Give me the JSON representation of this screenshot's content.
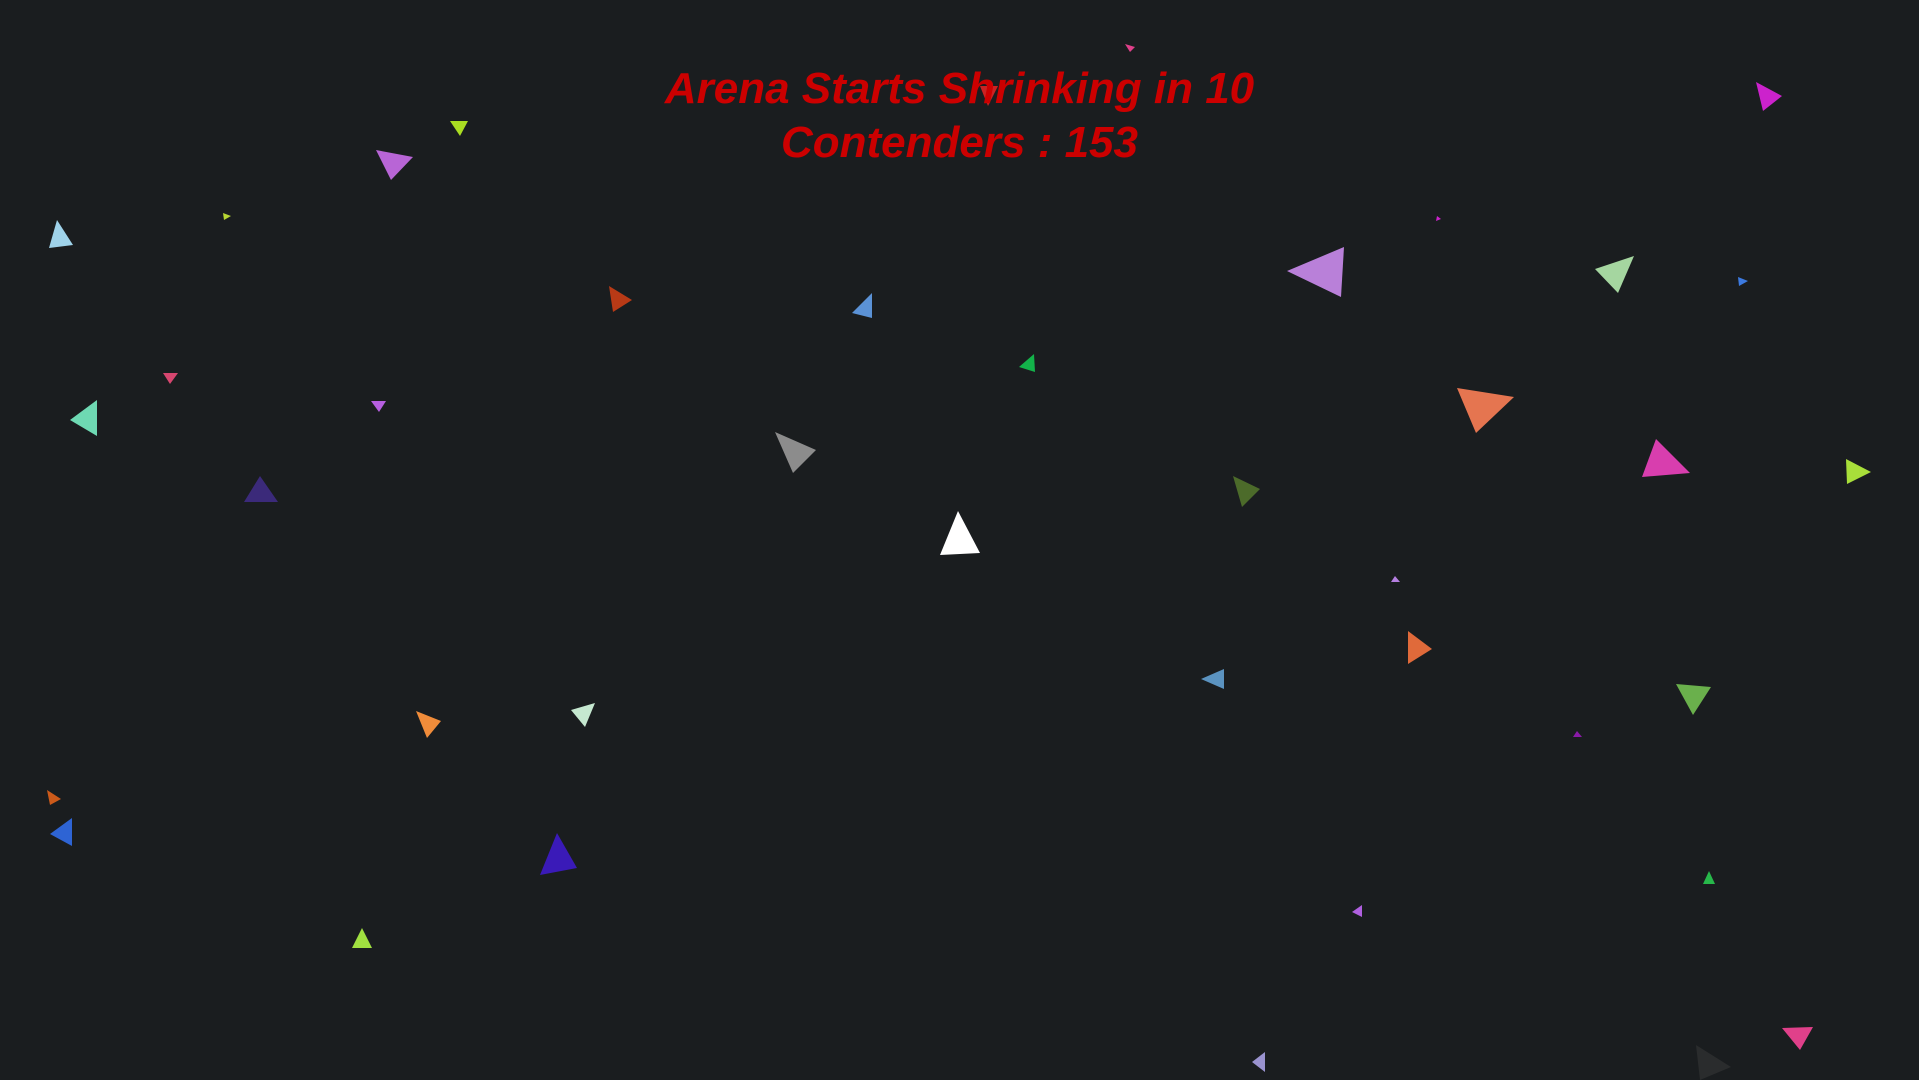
{
  "hud": {
    "countdown_text": "Arena Starts Shrinking in 10",
    "contenders_text": "Contenders : 153",
    "text_color": "#cc0000"
  },
  "arena": {
    "background_color": "#1a1d1f",
    "player_color": "#ffffff"
  },
  "contender_colors": [
    "#e0408a",
    "#cc22cc",
    "#aadd22",
    "#b865d6",
    "#9fd3ea",
    "#b7d633",
    "#cc2222",
    "#b83a16",
    "#5b92d6",
    "#b980d9",
    "#a5d6a0",
    "#3c7ae0",
    "#13b34a",
    "#d6466f",
    "#6ed9b3",
    "#b65fe0",
    "#8c8c8c",
    "#e57550",
    "#d83eae",
    "#a8df3a",
    "#3b2a7a",
    "#4c6b2a",
    "#b57fe0",
    "#e06a3a",
    "#5b93c0",
    "#6ab04c",
    "#8a1aa8",
    "#f08c3a",
    "#c5e8d0",
    "#cc5a1a",
    "#2e64d4",
    "#3a1ab8",
    "#a0e040",
    "#27b84a",
    "#b060e0",
    "#9a93cf",
    "#2a2c2d"
  ]
}
